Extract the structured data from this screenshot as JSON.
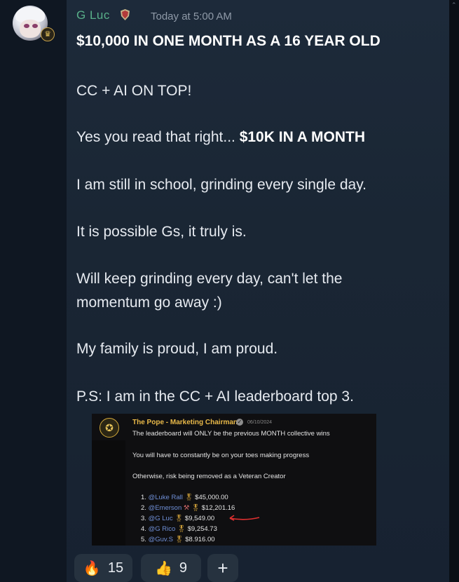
{
  "author": {
    "name": "G Luc",
    "timestamp": "Today at 5:00 AM"
  },
  "message": {
    "title": "$10,000 IN ONE MONTH AS A 16 YEAR OLD",
    "line1": "CC + AI ON TOP!",
    "line2_prefix": "Yes you read that right... ",
    "line2_bold": "$10K IN A MONTH",
    "line3": "I am still in school, grinding every single day.",
    "line4": "It is possible Gs, it truly is.",
    "line5a": "Will keep grinding every day, can't let the",
    "line5b": "momentum go away :)",
    "line6": "My family is proud, I am proud.",
    "line7": "P.S: I am in the CC + AI leaderboard top 3."
  },
  "embed": {
    "author": "The Pope - Marketing Chairman",
    "date": "06/10/2024",
    "text1": "The leaderboard will ONLY be the previous MONTH collective wins",
    "text2": "You will have to constantly be on your toes making progress",
    "text3": "Otherwise, risk being removed as a Veteran Creator",
    "leaderboard": [
      {
        "rank": "1.",
        "user": "@Luke Rall",
        "amount": "$45,000.00"
      },
      {
        "rank": "2.",
        "user": "@Emerson",
        "amount": "$12,201.16"
      },
      {
        "rank": "3.",
        "user": "@G Luc",
        "amount": "$9,549.00"
      },
      {
        "rank": "4.",
        "user": "@G Rico",
        "amount": "$9,254.73"
      },
      {
        "rank": "5.",
        "user": "@Guv.S",
        "amount": "$8.916.00"
      }
    ]
  },
  "reactions": [
    {
      "emoji": "🔥",
      "icon": "fire-icon",
      "count": "15"
    },
    {
      "emoji": "👍",
      "icon": "thumbs-up-icon",
      "count": "9"
    }
  ],
  "add_reaction_label": "+",
  "colors": {
    "username": "#59b08a",
    "timestamp": "#8f9aa8",
    "background": "#1a2634",
    "embed_author": "#e9b949",
    "mention": "#6f8fd6"
  }
}
